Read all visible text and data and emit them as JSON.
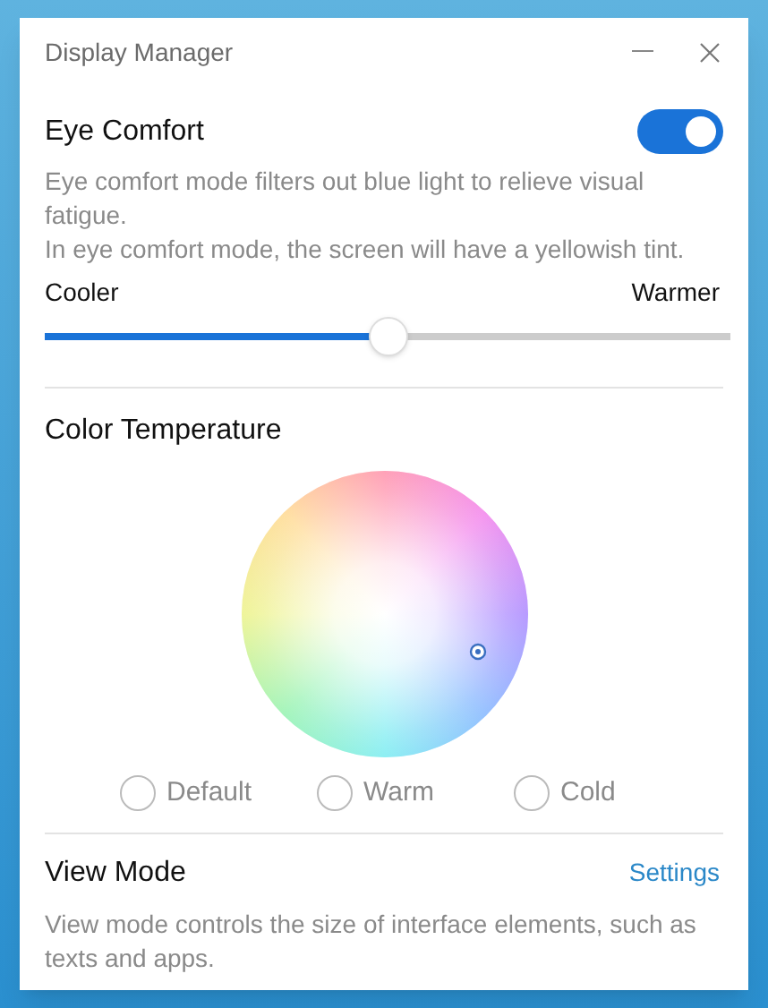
{
  "window": {
    "title": "Display Manager"
  },
  "eye_comfort": {
    "title": "Eye Comfort",
    "on": true,
    "description": "Eye comfort mode filters out blue light to relieve visual fatigue.",
    "note": "In eye comfort mode, the screen will have a yellowish tint.",
    "min_label": "Cooler",
    "max_label": "Warmer",
    "level": 0.5
  },
  "color_temperature": {
    "title": "Color Temperature",
    "options": [
      {
        "label": "Default",
        "selected": false
      },
      {
        "label": "Warm",
        "selected": false
      },
      {
        "label": "Cold",
        "selected": false
      }
    ]
  },
  "view_mode": {
    "title": "View Mode",
    "link": "Settings",
    "description": "View mode controls the size of interface elements, such as texts and apps."
  }
}
